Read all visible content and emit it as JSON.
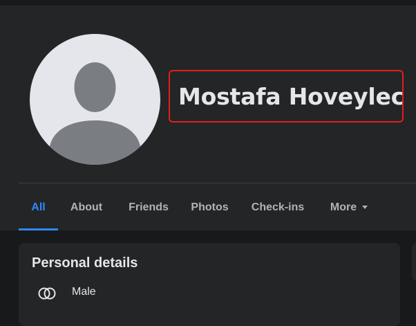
{
  "profile": {
    "name": "Mostafa Hoveylech"
  },
  "tabs": [
    {
      "label": "All",
      "active": true
    },
    {
      "label": "About",
      "active": false
    },
    {
      "label": "Friends",
      "active": false
    },
    {
      "label": "Photos",
      "active": false
    },
    {
      "label": "Check-ins",
      "active": false
    },
    {
      "label": "More",
      "active": false
    }
  ],
  "personal_details": {
    "title": "Personal details",
    "items": [
      {
        "icon": "gender-icon",
        "value": "Male"
      }
    ]
  },
  "colors": {
    "background": "#18191a",
    "surface": "#242526",
    "text_primary": "#e4e6eb",
    "text_secondary": "#b0b3b8",
    "accent": "#2d88ff",
    "highlight_border": "#e41e1e"
  }
}
